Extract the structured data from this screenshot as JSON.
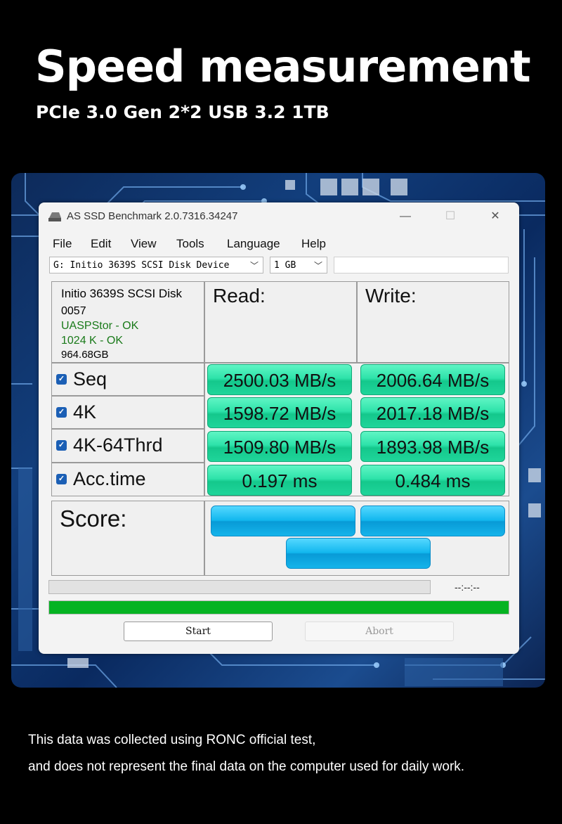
{
  "banner": {
    "headline": "Speed measurement",
    "subheadline": "PCIe 3.0 Gen 2*2 USB 3.2 1TB"
  },
  "window": {
    "title": "AS SSD Benchmark 2.0.7316.34247",
    "controls": {
      "minimize": "—",
      "maximize": "☐",
      "close": "✕"
    },
    "menu": [
      "File",
      "Edit",
      "View",
      "Tools",
      "Language",
      "Help"
    ],
    "device_select": "G: Initio 3639S SCSI Disk Device",
    "size_select": "1 GB",
    "extra_field": ""
  },
  "device_info": {
    "name": "Initio 3639S SCSI Disk",
    "firmware": "0057",
    "driver_status": "UASPStor - OK",
    "alignment_status": "1024 K - OK",
    "capacity": "964.68GB",
    "status_color": "#1a7a1a"
  },
  "columns": {
    "read": "Read:",
    "write": "Write:"
  },
  "results": [
    {
      "label": "Seq",
      "checked": true,
      "read": "2500.03 MB/s",
      "write": "2006.64 MB/s"
    },
    {
      "label": "4K",
      "checked": true,
      "read": "1598.72 MB/s",
      "write": "2017.18 MB/s"
    },
    {
      "label": "4K-64Thrd",
      "checked": true,
      "read": "1509.80 MB/s",
      "write": "1893.98 MB/s"
    },
    {
      "label": "Acc.time",
      "checked": true,
      "read": "0.197 ms",
      "write": "0.484 ms"
    }
  ],
  "score": {
    "label": "Score:",
    "read": "",
    "write": "",
    "total": ""
  },
  "progress": {
    "time": "--:--:--",
    "upper_fraction": 0.0,
    "lower_fraction": 1.0
  },
  "buttons": {
    "start": "Start",
    "abort": "Abort"
  },
  "colors": {
    "result_green": "#2ee3aa",
    "score_blue": "#11b7ee",
    "progress_green": "#05b322",
    "checkbox_blue": "#1b5fb5"
  },
  "disclaimer": {
    "line1": "This data was collected using RONC official test,",
    "line2": "and does not represent the final data on the computer used for daily work."
  }
}
